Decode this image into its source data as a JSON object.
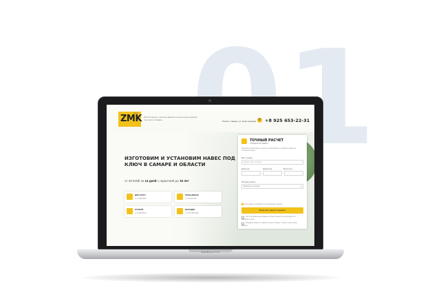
{
  "background_number": "01",
  "device": {
    "label": "MacBook Pro"
  },
  "site": {
    "logo": {
      "text": "ZMK",
      "sub": "group"
    },
    "tagline": "Изготовление и монтаж навесов и металлоконструкций под ключ в Самаре",
    "address": "Россия, Самара, ул. Ново-Садовая",
    "phone": "+8 925 653-22-31",
    "headline": "ИЗГОТОВИМ И УСТАНОВИМ НАВЕС ПОД КЛЮЧ В САМАРЕ И ОБЛАСТИ",
    "price": {
      "prefix": "от 49 840₽ за",
      "days": "14 дней",
      "middle": "с гарантией до",
      "years": "15 лет"
    },
    "cards": [
      {
        "title": "ДЛЯ АВТО",
        "sub": "от 4 900 ₽/м²"
      },
      {
        "title": "РОЛЬНЕВЫЕ",
        "sub": "от 5 200 ₽/м²"
      },
      {
        "title": "КАЧЕЛИ",
        "sub": "от 8 400 ₽/м²"
      },
      {
        "title": "БЕСЕДКИ",
        "sub": "от 170 000 ₽/м²"
      }
    ],
    "form": {
      "title": "ТОЧНЫЙ РАСЧЕТ",
      "subtitle": "СТОИМОСТИ НАВЕСА",
      "description": "Заполните свой номер, получите точный расчет стоимости навеса в течение 15 минут",
      "phone_label": "Ваш телефон",
      "phone_placeholder": "Введите ваш телефон",
      "size_labels": [
        "Длина (м)",
        "Ширина (м)",
        "Высота (м)"
      ],
      "select_label": "Материал кровли",
      "select_value": "Выберите из списка",
      "consent": "Я согласен на обработку персональных данных",
      "button": "Получить проект и расчет",
      "notes": [
        "Мы не передаем ваши данные третьим лицам и не используем их в рекламных целях",
        "Менеджер свяжется с вами в течение 15 минут и ответит на все ваши вопросы"
      ]
    }
  }
}
